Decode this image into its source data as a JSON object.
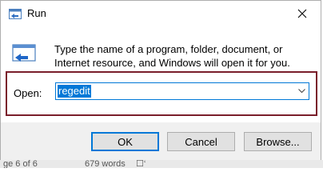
{
  "window": {
    "title": "Run",
    "close_icon": "close-icon",
    "app_icon": "run-icon"
  },
  "description": "Type the name of a program, folder, document, or Internet resource, and Windows will open it for you.",
  "open_field": {
    "label": "Open:",
    "value": "regedit",
    "dropdown_icon": "chevron-down-icon",
    "highlight_color": "#7a1e2b",
    "selection_color": "#0078d7"
  },
  "buttons": {
    "ok": "OK",
    "cancel": "Cancel",
    "browse": "Browse..."
  },
  "background_window": {
    "page_info": "ge 6 of 6",
    "word_count": "679 words",
    "extra": "☐‘"
  }
}
